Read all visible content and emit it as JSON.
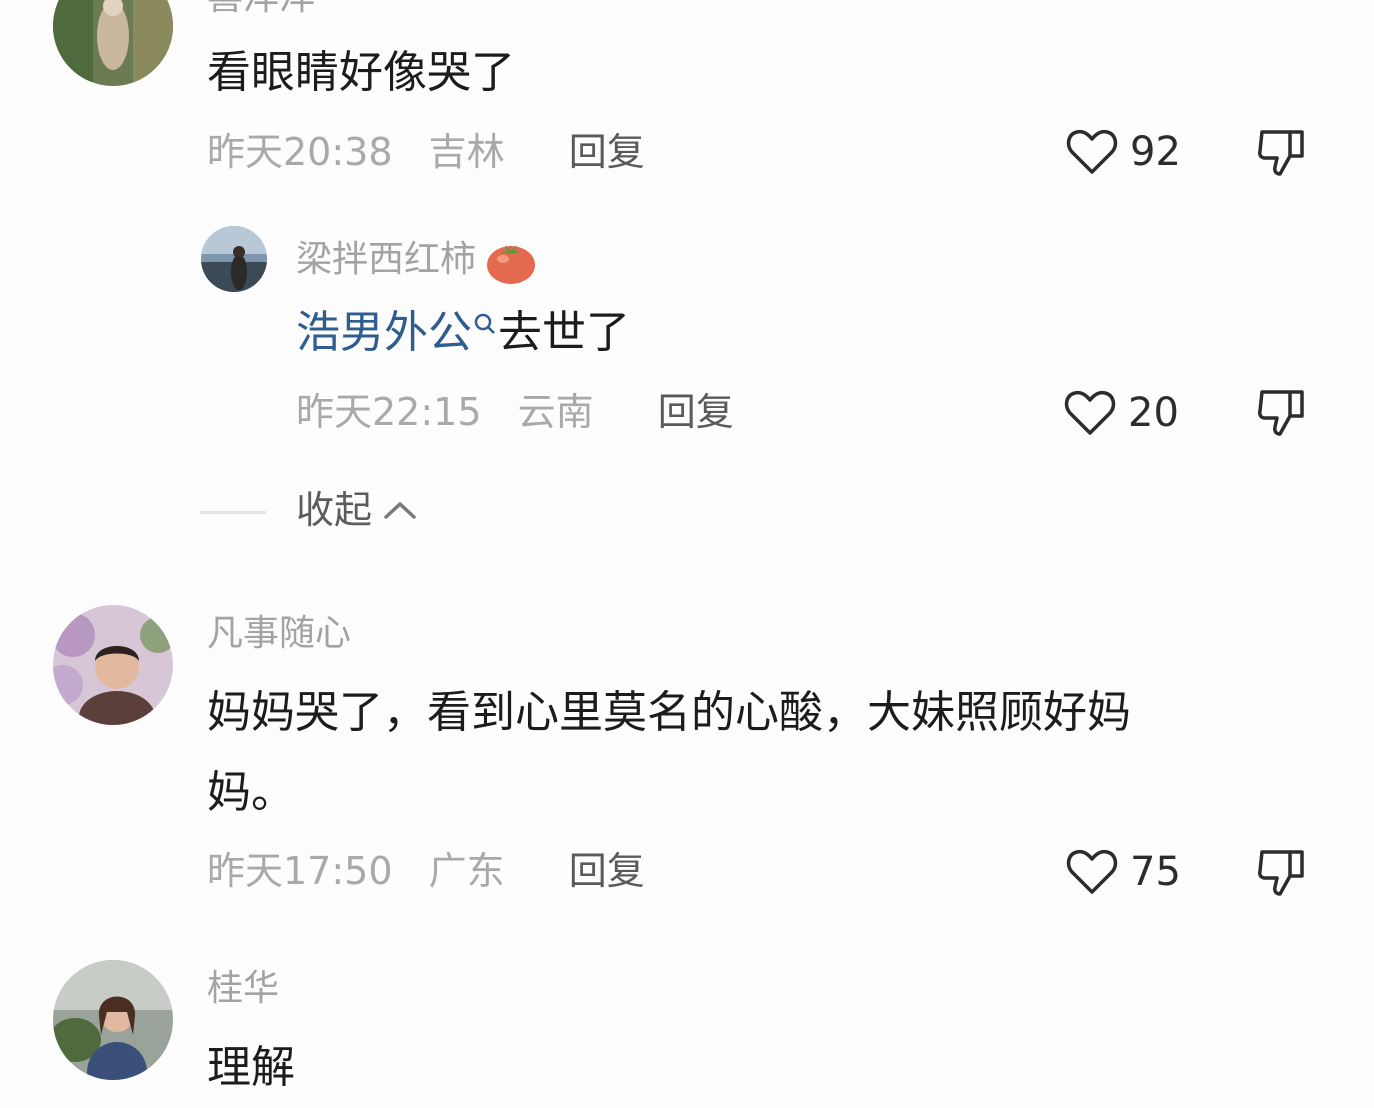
{
  "comments": [
    {
      "username": "喜洋洋",
      "text": "看眼睛好像哭了",
      "time": "昨天20:38",
      "location": "吉林",
      "reply_label": "回复",
      "likes": "92",
      "replies": [
        {
          "username": "梁拌西红柿",
          "mention": "浩男外公",
          "text": "去世了",
          "time": "昨天22:15",
          "location": "云南",
          "reply_label": "回复",
          "likes": "20"
        }
      ],
      "collapse_label": "收起"
    },
    {
      "username": "凡事随心",
      "text_line1": "妈妈哭了，看到心里莫名的心酸，大妹照顾好妈",
      "text_line2": "妈。",
      "time": "昨天17:50",
      "location": "广东",
      "reply_label": "回复",
      "likes": "75"
    },
    {
      "username": "桂华",
      "text": "理解"
    }
  ],
  "icons": {
    "like": "heart-outline-icon",
    "dislike": "thumbs-down-icon",
    "collapse": "chevron-up-icon",
    "mention": "search-icon",
    "emoji": "tomato-emoji"
  },
  "colors": {
    "link": "#2f5d8f",
    "secondary": "#a9a9a9",
    "primary": "#1c1c1c"
  }
}
